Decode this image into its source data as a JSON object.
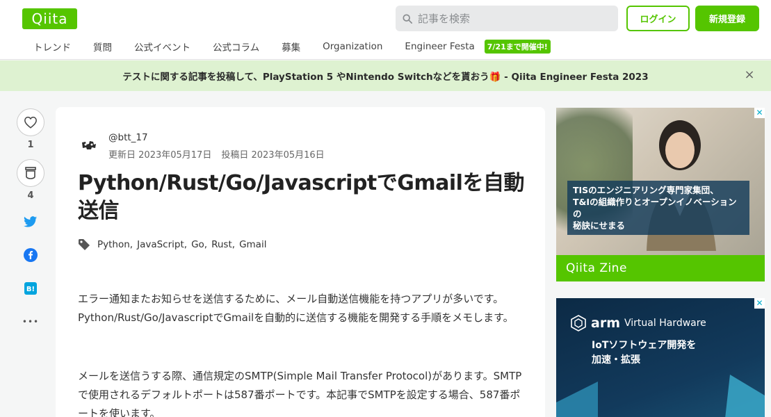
{
  "header": {
    "logo": "Qiita",
    "search_placeholder": "記事を検索",
    "login_label": "ログイン",
    "signup_label": "新規登録"
  },
  "nav": {
    "items": [
      "トレンド",
      "質問",
      "公式イベント",
      "公式コラム",
      "募集",
      "Organization",
      "Engineer Festa"
    ],
    "festa_badge": "7/21まで開催中!"
  },
  "banner": {
    "text": "テストに関する記事を投稿して、PlayStation 5 やNintendo Switchなどを貰おう🎁 - Qiita Engineer Festa 2023",
    "close": "×"
  },
  "actions": {
    "like_count": "1",
    "stock_count": "4",
    "more": "•••"
  },
  "article": {
    "author": "@btt_17",
    "updated_label": "更新日",
    "updated_date": "2023年05月17日",
    "posted_label": "投稿日",
    "posted_date": "2023年05月16日",
    "title": "Python/Rust/Go/JavascriptでGmailを自動送信",
    "tags": [
      "Python",
      "JavaScript",
      "Go",
      "Rust",
      "Gmail"
    ],
    "paragraphs": [
      "エラー通知またお知らせを送信するために、メール自動送信機能を持つアプリが多いです。Python/Rust/Go/JavascriptでGmailを自動的に送信する機能を開発する手順をメモします。",
      "メールを送信うする際、通信規定のSMTP(Simple Mail Transfer Protocol)があります。SMTPで使用されるデフォルトポートは587番ポートです。本記事でSMTPを設定する場合、587番ポートを使います。"
    ]
  },
  "ads": {
    "ad1_caption_line1": "TISのエンジニアリング専門家集団、",
    "ad1_caption_line2": "T&Iの組織作りとオープンイノベーションの",
    "ad1_caption_line3": "秘訣にせまる",
    "ad1_footer": "Qiita Zine",
    "ad2_brand": "arm",
    "ad2_brand_sub": "Virtual Hardware",
    "ad2_line1": "IoTソフトウェア開発を",
    "ad2_line2": "加速・拡張"
  },
  "colors": {
    "brand_green": "#55c500",
    "banner_bg": "#def2d1",
    "twitter": "#1d9bf0",
    "facebook": "#1877f2",
    "hatena": "#00a4de"
  }
}
